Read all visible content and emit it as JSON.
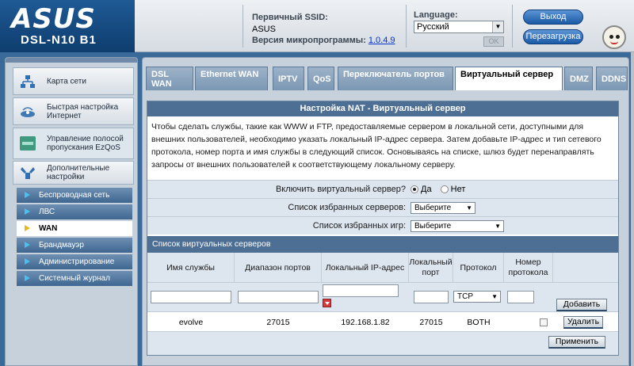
{
  "header": {
    "logo": "ASUS",
    "model": "DSL-N10 B1",
    "ssid_label": "Первичный SSID:",
    "ssid_value": "ASUS",
    "fw_label": "Версия микропрограммы:",
    "fw_value": "1.0.4.9",
    "language_label": "Language:",
    "language_value": "Русский",
    "ok_label": "OK",
    "logout_label": "Выход",
    "reboot_label": "Перезагрузка",
    "avatar_icon": "smiley-face-icon"
  },
  "sidebar": {
    "main_items": [
      {
        "label": "Карта сети",
        "icon": "network-map-icon"
      },
      {
        "label": "Быстрая настройка Интернет",
        "icon": "quick-setup-icon"
      },
      {
        "label": "Управление полосой пропускания EzQoS",
        "icon": "ezqos-icon"
      },
      {
        "label": "Дополнительные настройки",
        "icon": "advanced-settings-icon"
      }
    ],
    "sub_items": [
      {
        "label": "Беспроводная сеть",
        "active": false
      },
      {
        "label": "ЛВС",
        "active": false
      },
      {
        "label": "WAN",
        "active": true
      },
      {
        "label": "Брандмауэр",
        "active": false
      },
      {
        "label": "Администрирование",
        "active": false
      },
      {
        "label": "Системный журнал",
        "active": false
      }
    ]
  },
  "tabs": [
    {
      "label": "DSL WAN",
      "active": false
    },
    {
      "label": "Ethernet WAN",
      "active": false
    },
    {
      "label": "IPTV",
      "active": false
    },
    {
      "label": "QoS",
      "active": false
    },
    {
      "label": "Переключатель портов",
      "active": false
    },
    {
      "label": "Виртуальный сервер",
      "active": true
    },
    {
      "label": "DMZ",
      "active": false
    },
    {
      "label": "DDNS",
      "active": false
    }
  ],
  "panel": {
    "title": "Настройка NAT - Виртуальный сервер",
    "description": "Чтобы сделать службы, такие как WWW и FTP, предоставляемые сервером в локальной сети, доступными для внешних пользователей, необходимо указать локальный IP-адрес сервера. Затем добавьте IP-адрес и тип сетевого протокола, номер порта и имя службы в следующий список. Основываясь на списке, шлюз будет перенаправлять запросы от внешних пользователей к соответствующему локальному серверу.",
    "enable_label": "Включить виртуальный сервер?",
    "enable_yes": "Да",
    "enable_no": "Нет",
    "enable_value": "Да",
    "fav_servers_label": "Список избранных серверов:",
    "fav_servers_value": "Выберите",
    "fav_games_label": "Список избранных игр:",
    "fav_games_value": "Выберите",
    "list_title": "Список виртуальных серверов",
    "columns": [
      "Имя службы",
      "Диапазон портов",
      "Локальный IP-адрес",
      "Локальный порт",
      "Протокол",
      "Номер протокола"
    ],
    "new_protocol_value": "TCP",
    "add_label": "Добавить",
    "rows": [
      {
        "name": "evolve",
        "port_range": "27015",
        "local_ip": "192.168.1.82",
        "local_port": "27015",
        "protocol": "BOTH",
        "proto_num": ""
      }
    ],
    "delete_label": "Удалить",
    "apply_label": "Применить"
  }
}
